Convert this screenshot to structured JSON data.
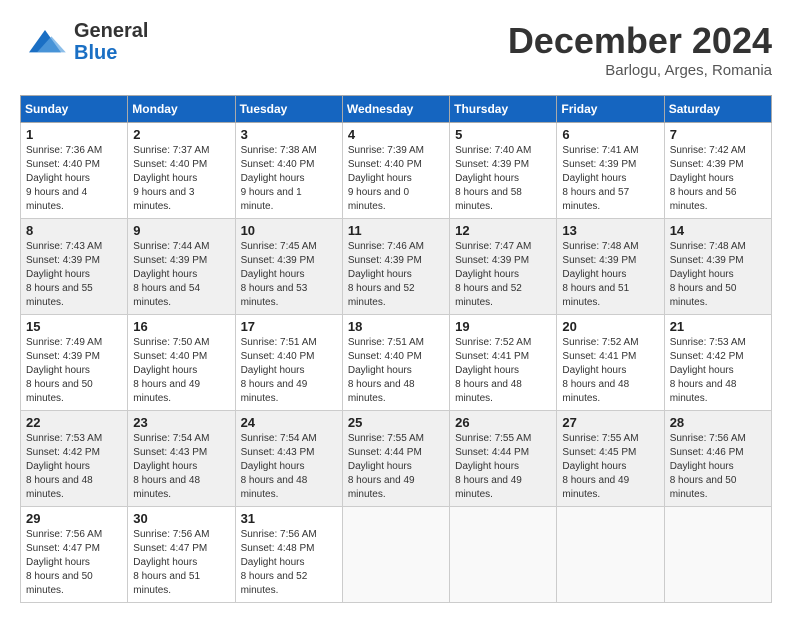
{
  "header": {
    "logo_general": "General",
    "logo_blue": "Blue",
    "month_title": "December 2024",
    "location": "Barlogu, Arges, Romania"
  },
  "days_of_week": [
    "Sunday",
    "Monday",
    "Tuesday",
    "Wednesday",
    "Thursday",
    "Friday",
    "Saturday"
  ],
  "weeks": [
    [
      {
        "day": "1",
        "sunrise": "7:36 AM",
        "sunset": "4:40 PM",
        "daylight": "9 hours and 4 minutes."
      },
      {
        "day": "2",
        "sunrise": "7:37 AM",
        "sunset": "4:40 PM",
        "daylight": "9 hours and 3 minutes."
      },
      {
        "day": "3",
        "sunrise": "7:38 AM",
        "sunset": "4:40 PM",
        "daylight": "9 hours and 1 minute."
      },
      {
        "day": "4",
        "sunrise": "7:39 AM",
        "sunset": "4:40 PM",
        "daylight": "9 hours and 0 minutes."
      },
      {
        "day": "5",
        "sunrise": "7:40 AM",
        "sunset": "4:39 PM",
        "daylight": "8 hours and 58 minutes."
      },
      {
        "day": "6",
        "sunrise": "7:41 AM",
        "sunset": "4:39 PM",
        "daylight": "8 hours and 57 minutes."
      },
      {
        "day": "7",
        "sunrise": "7:42 AM",
        "sunset": "4:39 PM",
        "daylight": "8 hours and 56 minutes."
      }
    ],
    [
      {
        "day": "8",
        "sunrise": "7:43 AM",
        "sunset": "4:39 PM",
        "daylight": "8 hours and 55 minutes."
      },
      {
        "day": "9",
        "sunrise": "7:44 AM",
        "sunset": "4:39 PM",
        "daylight": "8 hours and 54 minutes."
      },
      {
        "day": "10",
        "sunrise": "7:45 AM",
        "sunset": "4:39 PM",
        "daylight": "8 hours and 53 minutes."
      },
      {
        "day": "11",
        "sunrise": "7:46 AM",
        "sunset": "4:39 PM",
        "daylight": "8 hours and 52 minutes."
      },
      {
        "day": "12",
        "sunrise": "7:47 AM",
        "sunset": "4:39 PM",
        "daylight": "8 hours and 52 minutes."
      },
      {
        "day": "13",
        "sunrise": "7:48 AM",
        "sunset": "4:39 PM",
        "daylight": "8 hours and 51 minutes."
      },
      {
        "day": "14",
        "sunrise": "7:48 AM",
        "sunset": "4:39 PM",
        "daylight": "8 hours and 50 minutes."
      }
    ],
    [
      {
        "day": "15",
        "sunrise": "7:49 AM",
        "sunset": "4:39 PM",
        "daylight": "8 hours and 50 minutes."
      },
      {
        "day": "16",
        "sunrise": "7:50 AM",
        "sunset": "4:40 PM",
        "daylight": "8 hours and 49 minutes."
      },
      {
        "day": "17",
        "sunrise": "7:51 AM",
        "sunset": "4:40 PM",
        "daylight": "8 hours and 49 minutes."
      },
      {
        "day": "18",
        "sunrise": "7:51 AM",
        "sunset": "4:40 PM",
        "daylight": "8 hours and 48 minutes."
      },
      {
        "day": "19",
        "sunrise": "7:52 AM",
        "sunset": "4:41 PM",
        "daylight": "8 hours and 48 minutes."
      },
      {
        "day": "20",
        "sunrise": "7:52 AM",
        "sunset": "4:41 PM",
        "daylight": "8 hours and 48 minutes."
      },
      {
        "day": "21",
        "sunrise": "7:53 AM",
        "sunset": "4:42 PM",
        "daylight": "8 hours and 48 minutes."
      }
    ],
    [
      {
        "day": "22",
        "sunrise": "7:53 AM",
        "sunset": "4:42 PM",
        "daylight": "8 hours and 48 minutes."
      },
      {
        "day": "23",
        "sunrise": "7:54 AM",
        "sunset": "4:43 PM",
        "daylight": "8 hours and 48 minutes."
      },
      {
        "day": "24",
        "sunrise": "7:54 AM",
        "sunset": "4:43 PM",
        "daylight": "8 hours and 48 minutes."
      },
      {
        "day": "25",
        "sunrise": "7:55 AM",
        "sunset": "4:44 PM",
        "daylight": "8 hours and 49 minutes."
      },
      {
        "day": "26",
        "sunrise": "7:55 AM",
        "sunset": "4:44 PM",
        "daylight": "8 hours and 49 minutes."
      },
      {
        "day": "27",
        "sunrise": "7:55 AM",
        "sunset": "4:45 PM",
        "daylight": "8 hours and 49 minutes."
      },
      {
        "day": "28",
        "sunrise": "7:56 AM",
        "sunset": "4:46 PM",
        "daylight": "8 hours and 50 minutes."
      }
    ],
    [
      {
        "day": "29",
        "sunrise": "7:56 AM",
        "sunset": "4:47 PM",
        "daylight": "8 hours and 50 minutes."
      },
      {
        "day": "30",
        "sunrise": "7:56 AM",
        "sunset": "4:47 PM",
        "daylight": "8 hours and 51 minutes."
      },
      {
        "day": "31",
        "sunrise": "7:56 AM",
        "sunset": "4:48 PM",
        "daylight": "8 hours and 52 minutes."
      },
      null,
      null,
      null,
      null
    ]
  ],
  "labels": {
    "sunrise": "Sunrise:",
    "sunset": "Sunset:",
    "daylight": "Daylight hours"
  }
}
